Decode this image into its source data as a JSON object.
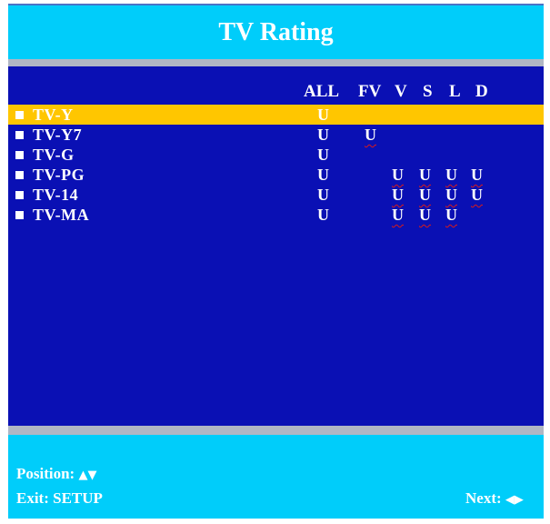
{
  "title": "TV Rating",
  "columns": [
    "ALL",
    "FV",
    "V",
    "S",
    "L",
    "D"
  ],
  "rows": [
    {
      "label": "TV-Y",
      "ALL": "U",
      "FV": "",
      "V": "",
      "S": "",
      "L": "",
      "D": ""
    },
    {
      "label": "TV-Y7",
      "ALL": "U",
      "FV": "U",
      "V": "",
      "S": "",
      "L": "",
      "D": ""
    },
    {
      "label": "TV-G",
      "ALL": "U",
      "FV": "",
      "V": "",
      "S": "",
      "L": "",
      "D": ""
    },
    {
      "label": "TV-PG",
      "ALL": "U",
      "FV": "",
      "V": "U",
      "S": "U",
      "L": "U",
      "D": "U"
    },
    {
      "label": "TV-14",
      "ALL": "U",
      "FV": "",
      "V": "U",
      "S": "U",
      "L": "U",
      "D": "U"
    },
    {
      "label": "TV-MA",
      "ALL": "U",
      "FV": "",
      "V": "U",
      "S": "U",
      "L": "U",
      "D": ""
    }
  ],
  "selected_row": "TV-Y",
  "footer": {
    "position_label": "Position:",
    "position_arrows": "▲▼",
    "exit_label": "Exit: SETUP",
    "next_label": "Next:",
    "next_arrows": "◀▶"
  },
  "colors": {
    "header": "#00cdfa",
    "panel": "#0a10b4",
    "highlight": "#ffc600",
    "separator": "#b0b6c4",
    "text": "#ffffff"
  }
}
